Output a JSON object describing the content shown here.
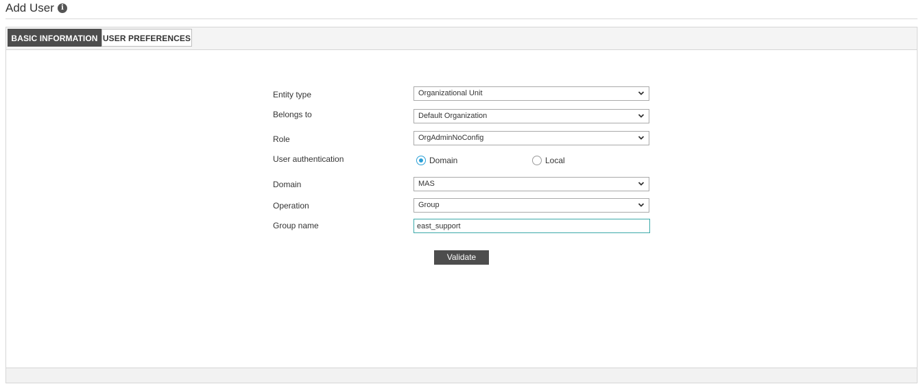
{
  "header": {
    "title": "Add User"
  },
  "tabs": [
    {
      "label": "BASIC INFORMATION",
      "active": true
    },
    {
      "label": "USER PREFERENCES",
      "active": false
    }
  ],
  "form": {
    "entity_type": {
      "label": "Entity type",
      "value": "Organizational Unit"
    },
    "belongs_to": {
      "label": "Belongs to",
      "value": "Default Organization"
    },
    "role": {
      "label": "Role",
      "value": "OrgAdminNoConfig"
    },
    "user_authentication": {
      "label": "User authentication",
      "options": [
        {
          "label": "Domain",
          "selected": true
        },
        {
          "label": "Local",
          "selected": false
        }
      ]
    },
    "domain": {
      "label": "Domain",
      "value": "MAS"
    },
    "operation": {
      "label": "Operation",
      "value": "Group"
    },
    "group_name": {
      "label": "Group name",
      "value": "east_support"
    },
    "validate_label": "Validate"
  },
  "icons": {
    "info": "info-circle-icon",
    "dropdown": "chevron-down-icon"
  },
  "colors": {
    "active_tab_bg": "#4d4d4d",
    "radio_accent": "#2a9fd6",
    "input_focus_border": "#3aa8a8",
    "button_bg": "#4d4d4d"
  }
}
